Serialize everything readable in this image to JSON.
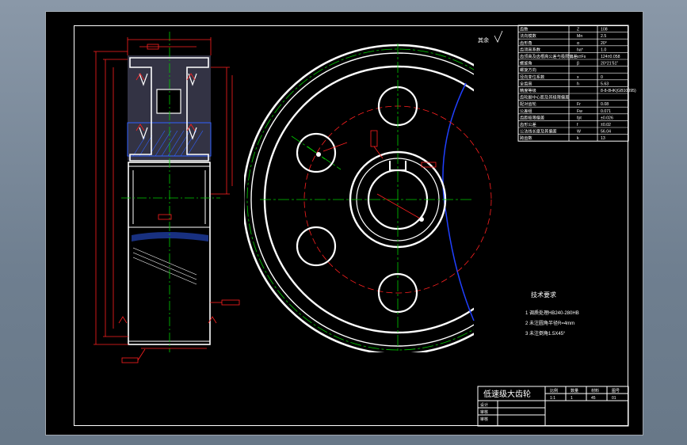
{
  "drawing": {
    "title": "低速级大齿轮",
    "tech_requirements": {
      "heading": "技术要求",
      "items": [
        "1 调质处理HB240-280HB",
        "2 未注圆角半径R=4mm",
        "3 未注倒角1.5X45°"
      ]
    },
    "roughness_note": "其余",
    "title_block": {
      "rows": [
        "设计",
        "审核",
        "审核"
      ],
      "cells": [
        "比例",
        "数量",
        "材料",
        "图号",
        "1:1",
        "1",
        "45",
        "01"
      ]
    },
    "gear_table": [
      {
        "label": "齿数",
        "sym": "Z",
        "val": "108"
      },
      {
        "label": "法向模数",
        "sym": "Mn",
        "val": "2.5"
      },
      {
        "label": "齿形角",
        "sym": "α",
        "val": "20°"
      },
      {
        "label": "齿顶高系数",
        "sym": "ha*",
        "val": "1.0"
      },
      {
        "label": "齿顶高及齿根高公差与极限偏差",
        "sym": "s±Fs",
        "val": "124±0.058"
      },
      {
        "label": "螺旋角",
        "sym": "β",
        "val": "20°21'51\""
      },
      {
        "label": "螺旋方向",
        "sym": "",
        "val": ""
      },
      {
        "label": "径向变位系数",
        "sym": "x",
        "val": "0"
      },
      {
        "label": "全齿高",
        "sym": "h",
        "val": "5.63"
      },
      {
        "label": "精度等级",
        "sym": "",
        "val": "8-8-8HK(GB10095)"
      },
      {
        "label": "齿轮副中心距及其极限偏差",
        "sym": "",
        "val": ""
      },
      {
        "label": "配对齿轮",
        "sym": "Fr",
        "val": "0.08"
      },
      {
        "label": "公差组",
        "sym": "Fw",
        "val": "0.071"
      },
      {
        "label": "齿距极限偏差",
        "sym": "fpt",
        "val": "±0.026"
      },
      {
        "label": "齿形公差",
        "sym": "f",
        "val": "±0.02"
      },
      {
        "label": "公法线长度及其偏差",
        "sym": "W",
        "val": "56.04"
      },
      {
        "label": "跨齿数",
        "sym": "k",
        "val": "13"
      }
    ]
  },
  "colors": {
    "outline": "#ffffff",
    "center": "#00cc00",
    "dimension": "#ff2020",
    "hatch": "#3060ff",
    "section": "#333344"
  }
}
